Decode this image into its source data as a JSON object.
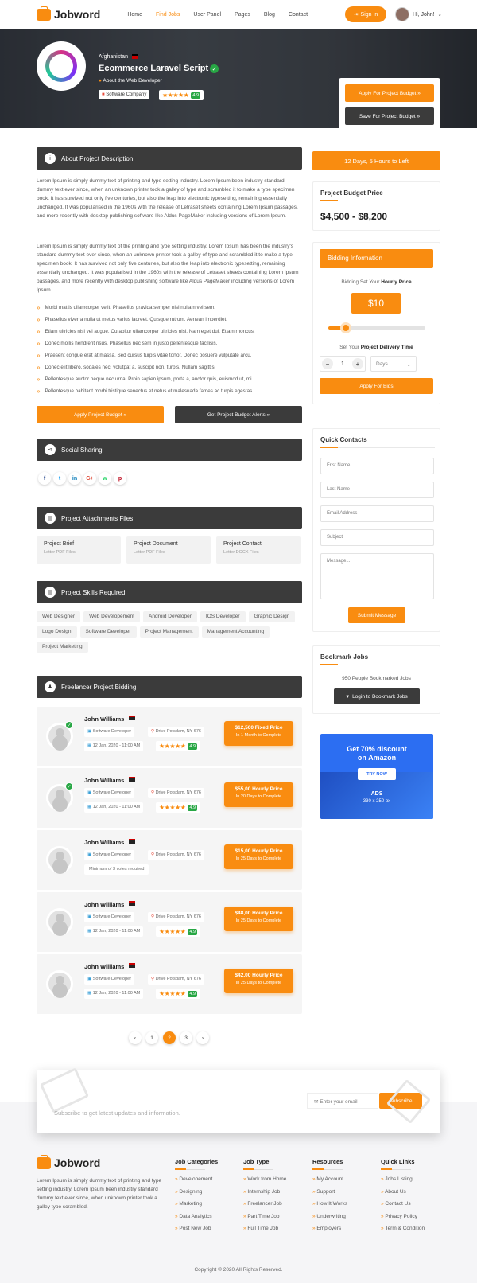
{
  "header": {
    "brand": "Jobword",
    "nav": [
      {
        "label": "Home",
        "active": false
      },
      {
        "label": "Find Jobs",
        "active": true
      },
      {
        "label": "User Panel",
        "active": false
      },
      {
        "label": "Pages",
        "active": false
      },
      {
        "label": "Blog",
        "active": false
      },
      {
        "label": "Contact",
        "active": false
      }
    ],
    "sign_in": "Sign In",
    "user_greeting": "Hi, John!"
  },
  "hero": {
    "country": "Afghanistan",
    "title": "Ecommerce Laravel Script",
    "about_link": "About the Web Developer",
    "company_badge": "Software Company",
    "rating": "4.9",
    "apply_btn": "Apply For Project Budget",
    "save_btn": "Save For Project Budget"
  },
  "description": {
    "heading": "About Project Description",
    "para1": "Lorem Ipsum is simply dummy text of printing and type setting industry. Lorem Ipsum been industry standard dummy text ever since, when an unknown printer took a galley of type and scrambled it to make a type specimen book. It has survived not only five centuries, but also the leap into electronic typesetting, remaining essentially unchanged. It was popularised in the 1960s with the release of Letraset sheets containing Lorem Ipsum passages, and more recently with desktop publishing software like Aldus PageMaker including versions of Lorem Ipsum.",
    "para2": "Lorem Ipsum is simply dummy text of the printing and type setting industry. Lorem Ipsum has been the industry's standard dummy text ever since, when an unknown printer took a galley of type and scrambled it to make a type specimen book. It has survived not only five centuries, but also the leap into electronic typesetting, remaining essentially unchanged. It was popularised in the 1960s with the release of Letraset sheets containing Lorem Ipsum passages, and more recently with desktop publishing software like Aldus PageMaker including versions of Lorem Ipsum.",
    "bullets": [
      "Morbi mattis ullamcorper velit. Phasellus gravida semper nisi nullam vel sem.",
      "Phasellus viverra nulla ut metus varius laoreet. Quisque rutrum. Aenean imperdiet.",
      "Etiam ultricies nisi vel augue. Curabitur ullamcorper ultricies nisi. Nam eget dui. Etiam rhoncus.",
      "Donec mollis hendrerit risus. Phasellus nec sem in justo pellentesque facilisis.",
      "Praesent congue erat at massa. Sed cursus turpis vitae tortor. Donec posuere vulputate arcu.",
      "Donec elit libero, sodales nec, volutpat a, suscipit non, turpis. Nullam sagittis.",
      "Pellentesque auctor neque nec urna. Proin sapien ipsum, porta a, auctor quis, euismod ut, mi.",
      "Pellentesque habitant morbi tristique senectus et netus et malesuada fames ac turpis egestas."
    ],
    "apply_btn": "Apply Project Budget",
    "alerts_btn": "Get Project Budget Alerts"
  },
  "social": {
    "heading": "Social Sharing",
    "icons": [
      "f",
      "t",
      "in",
      "G+",
      "w",
      "p"
    ]
  },
  "attachments": {
    "heading": "Project Attachments Files",
    "files": [
      {
        "title": "Project Brief",
        "type": "Letter PDF Files"
      },
      {
        "title": "Project Document",
        "type": "Letter PDF Files"
      },
      {
        "title": "Project Contact",
        "type": "Letter DOCX Files"
      }
    ]
  },
  "skills": {
    "heading": "Project Skills Required",
    "tags": [
      "Web Designer",
      "Web Developement",
      "Android Developer",
      "IOS Developer",
      "Graphic Design",
      "Logo Design",
      "Software Developer",
      "Project Management",
      "Management Accounting",
      "Project Marketing"
    ]
  },
  "bidding": {
    "heading": "Freelancer Project Bidding",
    "bids": [
      {
        "name": "John Williams",
        "role": "Software Developer",
        "location": "Drive Potsdam, NY 676",
        "date": "12 Jan, 2020 - 11:00 AM",
        "rating": "4.9",
        "price": "$12,500 Fixed Price",
        "term": "In 1 Month to Complete",
        "verified": true
      },
      {
        "name": "John Williams",
        "role": "Software Developer",
        "location": "Drive Potsdam, NY 676",
        "date": "12 Jan, 2020 - 11:00 AM",
        "rating": "4.9",
        "price": "$55,00 Hourly Price",
        "term": "In 20 Days to Complete",
        "verified": true
      },
      {
        "name": "John Williams",
        "role": "Software Developer",
        "location": "Drive Potsdam, NY 676",
        "note": "Minimum of 3 votes required",
        "price": "$15,00 Hourly Price",
        "term": "In 25 Days to Complete",
        "verified": false
      },
      {
        "name": "John Williams",
        "role": "Software Developer",
        "location": "Drive Potsdam, NY 676",
        "date": "12 Jan, 2020 - 11:00 AM",
        "rating": "4.9",
        "price": "$48,00 Hourly Price",
        "term": "In 25 Days to Complete",
        "verified": false
      },
      {
        "name": "John Williams",
        "role": "Software Developer",
        "location": "Drive Potsdam, NY 676",
        "date": "12 Jan, 2020 - 11:00 AM",
        "rating": "4.9",
        "price": "$42,00 Hourly Price",
        "term": "In 25 Days to Complete",
        "verified": false
      }
    ],
    "pages": [
      "1",
      "2",
      "3"
    ],
    "current_page": "2"
  },
  "sidebar": {
    "timeleft": "12 Days, 5 Hours to Left",
    "budget_title": "Project Budget Price",
    "budget_value": "$4,500 - $8,200",
    "bidding_title": "Bidding Information",
    "hourly_label": "Bidding Set Your",
    "hourly_bold": "Hourly Price",
    "hourly_value": "$10",
    "slider_level": 0.18,
    "delivery_label": "Set Your",
    "delivery_bold": "Project Delivery Time",
    "qty": "1",
    "unit": "Days",
    "apply_bids": "Apply For Bids",
    "contacts_title": "Quick Contacts",
    "first_name": "Frist Name",
    "last_name": "Last Name",
    "email": "Email Address",
    "subject": "Subject",
    "message": "Message...",
    "submit": "Submit Message",
    "bookmark_title": "Bookmark Jobs",
    "bookmark_count": "950 People Bookmarked Jobs",
    "bookmark_btn": "Login to Bookmark Jobs",
    "ad_line1": "Get 70% discount",
    "ad_line2": "on Amazon",
    "ad_btn": "TRY NOW",
    "ad_label": "ADS",
    "ad_size": "330 x 250 px"
  },
  "subscribe": {
    "text": "Subscribe to get latest updates and information.",
    "placeholder": "Enter your email",
    "button": "Subscribe"
  },
  "footer": {
    "brand": "Jobword",
    "about": "Lorem Ipsum is simply dummy text of printing and type setting industry. Lorem Ipsum been industry standard dummy text ever since, when unknown printer took a galley type scrambled.",
    "columns": [
      {
        "title": "Job Categories",
        "items": [
          "Developement",
          "Designing",
          "Marketing",
          "Data Analytics",
          "Post New Job"
        ]
      },
      {
        "title": "Job Type",
        "items": [
          "Work from Home",
          "Internship Job",
          "Freelancer Job",
          "Part Time Job",
          "Full Time Job"
        ]
      },
      {
        "title": "Resources",
        "items": [
          "My Account",
          "Support",
          "How It Works",
          "Underwriting",
          "Employers"
        ]
      },
      {
        "title": "Quick Links",
        "items": [
          "Jobs Listing",
          "About Us",
          "Contact Us",
          "Privacy Policy",
          "Term & Condition"
        ]
      }
    ],
    "copyright": "Copyright © 2020 All Rights Reserved."
  },
  "colors": {
    "accent": "#f98c10",
    "dark": "#3b3b3b",
    "success": "#28a745"
  }
}
